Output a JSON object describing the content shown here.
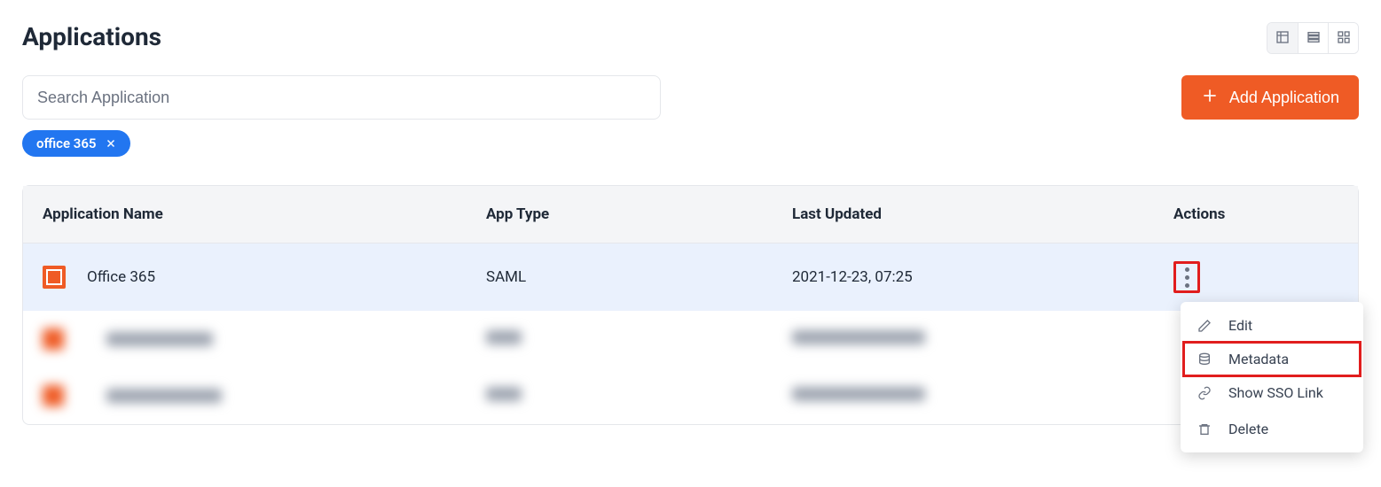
{
  "header": {
    "title": "Applications"
  },
  "search": {
    "placeholder": "Search Application"
  },
  "filter_chip": {
    "label": "office 365"
  },
  "add_button": {
    "label": "Add Application"
  },
  "table": {
    "columns": {
      "name": "Application Name",
      "type": "App Type",
      "updated": "Last Updated",
      "actions": "Actions"
    },
    "rows": [
      {
        "name": "Office 365",
        "type": "SAML",
        "updated": "2021-12-23, 07:25"
      }
    ]
  },
  "menu": {
    "edit": "Edit",
    "metadata": "Metadata",
    "show_sso": "Show SSO Link",
    "delete": "Delete"
  }
}
